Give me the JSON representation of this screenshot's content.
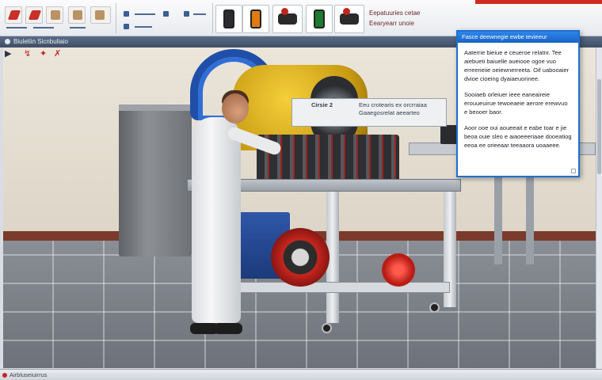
{
  "window": {
    "title": "Biuletiin Sicnbuliaio"
  },
  "toolbar": {
    "catalog_line1": "Eepatuuries cetae",
    "catalog_line2": "Eearyearr unoie"
  },
  "quick_actions": [
    "▶",
    "↯",
    "✦",
    "✗"
  ],
  "scene": {
    "sign_left": "Cirsie 2",
    "sign_right_line1": "Eeu crotearis ex orcrraiaa",
    "sign_right_line2": "Gaaegosrelat aeearteo"
  },
  "dialog": {
    "title": "Fasce deewnegie ewbe tevieeur",
    "paragraphs": [
      "Aaterrie bieiue e ceueroe relatnr. Tee aiebueti baiuelle aueiooe ogoe vuo erreerieiie oeiewnerreeta. Oif uabooaier dvioe cioeing dyaiaeuorinee.",
      "Sooiaeb orleiuer ieee eaneaireie erouueuirue tewoeaeie aerore erewvuo e beooer baor.",
      "Aoor ooe oui aoueeait e eabe toar e jie beoa ouie sleo e aiaoeeeriaae dooeatiog eeoa ee orieeaar teeaaora uoaaeee."
    ]
  },
  "statusbar": {
    "text": "Airbluseiuirrus"
  },
  "colors": {
    "accent": "#1d6fd3",
    "brand_red": "#d12b22"
  }
}
